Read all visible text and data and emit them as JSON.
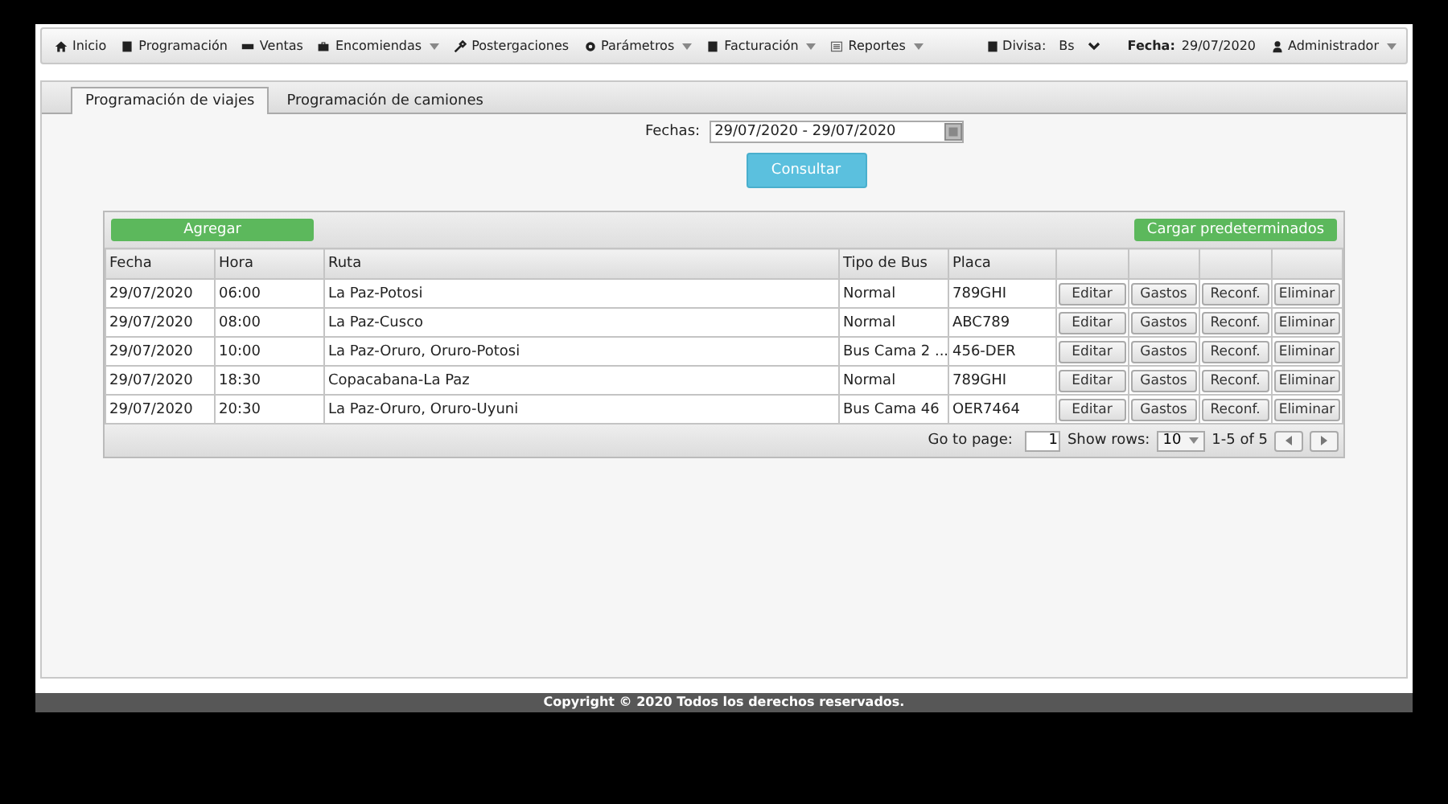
{
  "nav": {
    "items": [
      {
        "label": "Inicio",
        "dropdown": false
      },
      {
        "label": "Programación",
        "dropdown": false
      },
      {
        "label": "Ventas",
        "dropdown": false
      },
      {
        "label": "Encomiendas",
        "dropdown": true
      },
      {
        "label": "Postergaciones",
        "dropdown": false
      },
      {
        "label": "Parámetros",
        "dropdown": true
      },
      {
        "label": "Facturación",
        "dropdown": true
      },
      {
        "label": "Reportes",
        "dropdown": true
      }
    ],
    "currency": {
      "label": "Divisa:",
      "value": "Bs"
    },
    "date": {
      "label": "Fecha:",
      "value": "29/07/2020"
    },
    "user": {
      "label": "Administrador",
      "dropdown": true
    }
  },
  "tabs": [
    {
      "label": "Programación de viajes",
      "selected": true
    },
    {
      "label": "Programación de camiones",
      "selected": false
    }
  ],
  "filter": {
    "label": "Fechas:",
    "value": "29/07/2020 - 29/07/2020",
    "button": "Consultar"
  },
  "grid": {
    "add_button": "Agregar",
    "load_button": "Cargar predeterminados",
    "columns": [
      "Fecha",
      "Hora",
      "Ruta",
      "Tipo de Bus",
      "Placa"
    ],
    "rows": [
      {
        "cells": [
          "29/07/2020",
          "06:00",
          "La Paz-Potosi",
          "Normal",
          "789GHI"
        ],
        "actions": [
          "Editar",
          "Gastos",
          "Reconf.",
          "Eliminar"
        ]
      },
      {
        "cells": [
          "29/07/2020",
          "08:00",
          "La Paz-Cusco",
          "Normal",
          "ABC789"
        ],
        "actions": [
          "Editar",
          "Gastos",
          "Reconf.",
          "Eliminar"
        ]
      },
      {
        "cells": [
          "29/07/2020",
          "10:00",
          "La Paz-Oruro, Oruro-Potosi",
          "Bus Cama 2 ...",
          "456-DER"
        ],
        "actions": [
          "Editar",
          "Gastos",
          "Reconf.",
          "Eliminar"
        ]
      },
      {
        "cells": [
          "29/07/2020",
          "18:30",
          "Copacabana-La Paz",
          "Normal",
          "789GHI"
        ],
        "actions": [
          "Editar",
          "Gastos",
          "Reconf.",
          "Eliminar"
        ]
      },
      {
        "cells": [
          "29/07/2020",
          "20:30",
          "La Paz-Oruro, Oruro-Uyuni",
          "Bus Cama 46",
          "OER7464"
        ],
        "actions": [
          "Editar",
          "Gastos",
          "Reconf.",
          "Eliminar"
        ]
      }
    ],
    "pager": {
      "goto_label": "Go to page:",
      "page": "1",
      "rows_label": "Show rows:",
      "rows_value": "10",
      "range": "1-5 of 5"
    }
  },
  "footer": "Copyright © 2020 Todos los derechos reservados."
}
